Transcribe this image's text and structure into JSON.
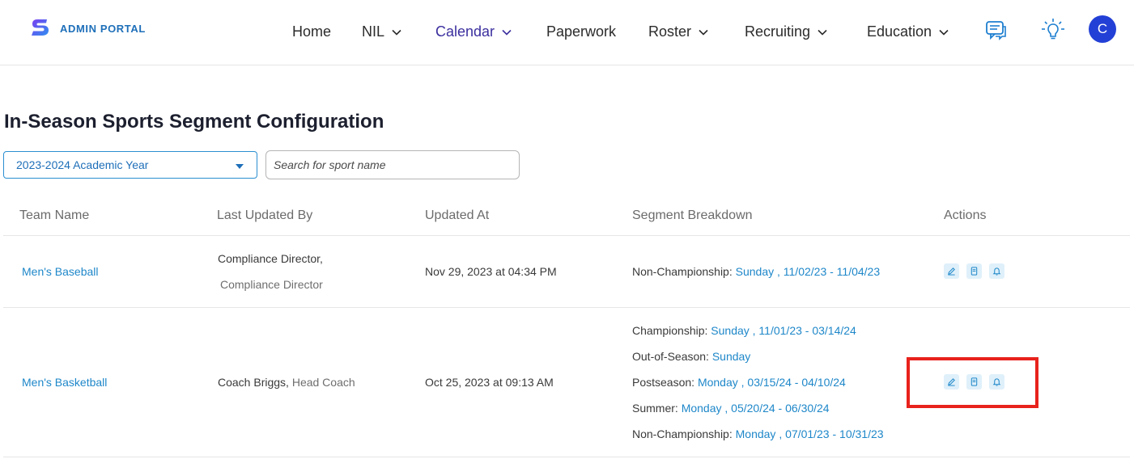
{
  "header": {
    "logo_text": "ADMIN PORTAL",
    "nav": [
      {
        "label": "Home"
      },
      {
        "label": "NIL"
      },
      {
        "label": "Calendar"
      },
      {
        "label": "Paperwork"
      },
      {
        "label": "Roster"
      },
      {
        "label": "Recruiting"
      },
      {
        "label": "Education"
      }
    ],
    "icons": [
      "chat-icon",
      "lightbulb-icon"
    ],
    "avatar_initial": "C"
  },
  "page": {
    "title": "In-Season Sports Segment Configuration",
    "year_select": {
      "value": "2023-2024 Academic Year"
    },
    "search": {
      "placeholder": "Search for sport name"
    }
  },
  "table": {
    "columns": [
      "Team Name",
      "Last Updated By",
      "Updated At",
      "Segment Breakdown",
      "Actions"
    ],
    "rows": [
      {
        "team": "Men's Baseball",
        "updated_by_name": "Compliance Director,",
        "updated_by_role": "Compliance Director",
        "updated_at": "Nov 29, 2023 at 04:34 PM",
        "segments": [
          {
            "label": "Non-Championship: ",
            "value": "Sunday , 11/02/23 - 11/04/23"
          }
        ]
      },
      {
        "team": "Men's Basketball",
        "updated_by_name": "Coach Briggs,",
        "updated_by_role": "Head Coach",
        "updated_at": "Oct 25, 2023 at 09:13 AM",
        "segments": [
          {
            "label": "Championship: ",
            "value": "Sunday , 11/01/23 - 03/14/24"
          },
          {
            "label": "Out-of-Season: ",
            "value": "Sunday"
          },
          {
            "label": "Postseason: ",
            "value": "Monday , 03/15/24 - 04/10/24"
          },
          {
            "label": "Summer: ",
            "value": "Monday , 05/20/24 - 06/30/24"
          },
          {
            "label": "Non-Championship: ",
            "value": "Monday , 07/01/23 - 10/31/23"
          }
        ]
      }
    ],
    "action_icons": [
      "edit-icon",
      "document-icon",
      "bell-icon"
    ]
  },
  "colors": {
    "accent": "#1e87c9",
    "active_nav": "#3b2f9e",
    "avatar": "#2340d6",
    "highlight": "#e8221c"
  }
}
